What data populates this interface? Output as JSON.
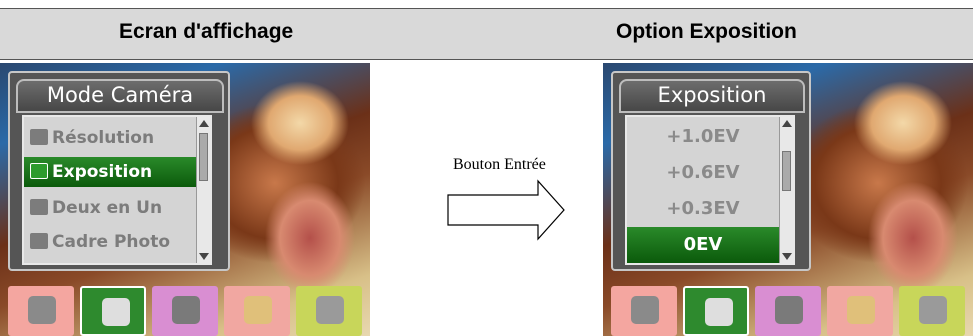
{
  "headings": {
    "left": "Ecran d'affichage",
    "right": "Option Exposition"
  },
  "button_label": "Bouton Entrée",
  "left_screen": {
    "menu_title": "Mode Caméra",
    "items": [
      {
        "label": "Résolution",
        "icon": "resolution-icon",
        "selected": false
      },
      {
        "label": "Exposition",
        "icon": "exposure-icon",
        "selected": true
      },
      {
        "label": "Deux en Un",
        "icon": "two-in-one-icon",
        "selected": false
      },
      {
        "label": "Cadre Photo",
        "icon": "photo-frame-icon",
        "selected": false
      }
    ]
  },
  "right_screen": {
    "menu_title": "Exposition",
    "options": [
      "+1.0EV",
      "+0.6EV",
      "+0.3EV",
      "0EV"
    ],
    "selected": "0EV"
  },
  "mode_tabs": [
    {
      "icon": "video-camera-icon",
      "bg": "#f4a6a0"
    },
    {
      "icon": "camera-icon",
      "bg": "#2e8a2e",
      "selected": true
    },
    {
      "icon": "microphone-icon",
      "bg": "#d98ed2"
    },
    {
      "icon": "palette-icon",
      "bg": "#f1a7a1"
    },
    {
      "icon": "tools-icon",
      "bg": "#c8d65a"
    }
  ],
  "colors": {
    "highlight": "#1a7a1a",
    "menu_panel": "#d4d4d4",
    "header_bg": "#d9d9d9"
  }
}
